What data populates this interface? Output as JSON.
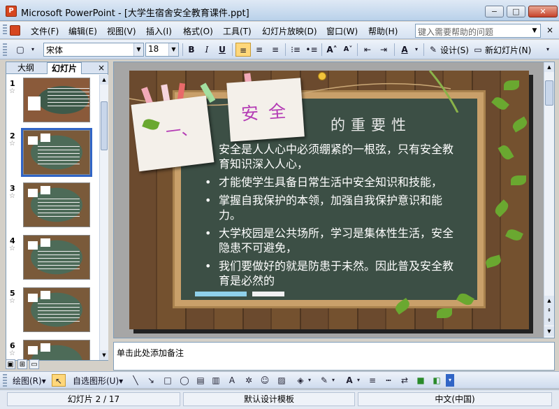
{
  "window": {
    "title": "Microsoft PowerPoint - [大学生宿舍安全教育课件.ppt]",
    "app_icon": "powerpoint-icon",
    "minimize": "−",
    "maximize": "□",
    "close": "✕"
  },
  "menu": {
    "items": [
      "文件(F)",
      "编辑(E)",
      "视图(V)",
      "插入(I)",
      "格式(O)",
      "工具(T)",
      "幻灯片放映(D)",
      "窗口(W)",
      "帮助(H)"
    ],
    "help_placeholder": "键入需要帮助的问题",
    "help_dropdown": "▼",
    "close_doc": "×"
  },
  "toolbar": {
    "font_name": "宋体",
    "font_size": "18",
    "bold": "B",
    "italic": "I",
    "underline": "U",
    "design_label": "设计(S)",
    "new_slide_label": "新幻灯片(N)"
  },
  "left_panel": {
    "tab_outline": "大纲",
    "tab_slides": "幻灯片",
    "close": "×",
    "slides": [
      {
        "num": "1"
      },
      {
        "num": "2"
      },
      {
        "num": "3"
      },
      {
        "num": "4"
      },
      {
        "num": "5"
      },
      {
        "num": "6"
      }
    ],
    "selected_index": 2
  },
  "slide": {
    "card1_text": "一、",
    "card2_text": "安全",
    "heading": "的重要性",
    "bullets": [
      {
        "marker": "",
        "text": "安全是人人心中必须绷紧的一根弦，只有安全教育知识深入人心，"
      },
      {
        "marker": "•",
        "text": "才能使学生具备日常生活中安全知识和技能，"
      },
      {
        "marker": "•",
        "text": "掌握自我保护的本领，加强自我保护意识和能力。"
      },
      {
        "marker": "•",
        "text": "大学校园是公共场所，学习是集体性生活，安全隐患不可避免，"
      },
      {
        "marker": "•",
        "text": "我们要做好的就是防患于未然。因此普及安全教育是必然的"
      }
    ]
  },
  "notes": {
    "placeholder": "单击此处添加备注"
  },
  "drawbar": {
    "draw_menu": "绘图(R)▾",
    "autoshapes_menu": "自选图形(U)▾"
  },
  "status": {
    "slide_info": "幻灯片 2 / 17",
    "template": "默认设计模板",
    "language": "中文(中国)"
  },
  "colors": {
    "accent": "#b43bb5",
    "board": "#3c4f45",
    "selection": "#3165c6"
  }
}
